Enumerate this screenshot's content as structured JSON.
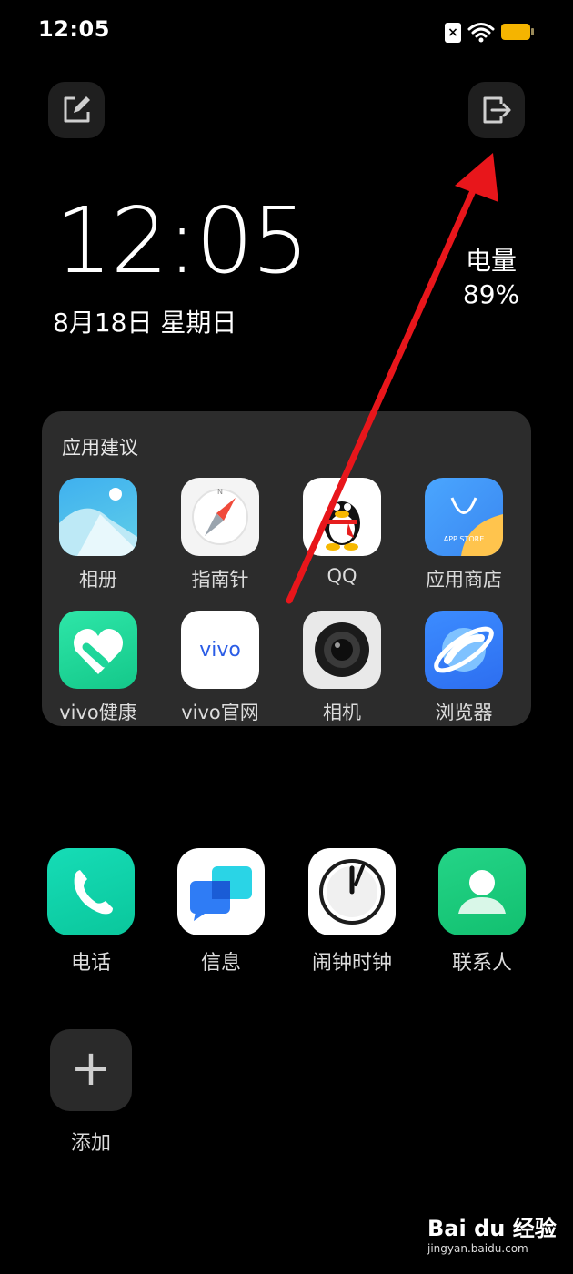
{
  "status_bar": {
    "time": "12:05",
    "sim_glyph": "×",
    "icons": [
      "sim-off-icon",
      "wifi-icon",
      "battery-icon"
    ]
  },
  "clock": {
    "time": "12:05",
    "date": "8月18日  星期日"
  },
  "battery_widget": {
    "label": "电量",
    "value": "89%"
  },
  "suggestions": {
    "title": "应用建议",
    "apps": [
      {
        "label": "相册",
        "icon": "gallery-icon"
      },
      {
        "label": "指南针",
        "icon": "compass-icon"
      },
      {
        "label": "QQ",
        "icon": "qq-icon"
      },
      {
        "label": "应用商店",
        "icon": "app-store-icon",
        "badge": "APP STORE"
      },
      {
        "label": "vivo健康",
        "icon": "health-icon"
      },
      {
        "label": "vivo官网",
        "icon": "vivo-site-icon",
        "logo_text": "vivo"
      },
      {
        "label": "相机",
        "icon": "camera-icon"
      },
      {
        "label": "浏览器",
        "icon": "browser-icon"
      }
    ]
  },
  "dock": {
    "apps": [
      {
        "label": "电话",
        "icon": "phone-icon"
      },
      {
        "label": "信息",
        "icon": "messages-icon"
      },
      {
        "label": "闹钟时钟",
        "icon": "clock-icon"
      },
      {
        "label": "联系人",
        "icon": "contacts-icon"
      }
    ]
  },
  "add": {
    "label": "添加",
    "glyph": "+"
  },
  "watermark": {
    "logo": "Bai du 经验",
    "url": "jingyan.baidu.com"
  },
  "colors": {
    "background": "#000000",
    "card": "#2c2c2c",
    "annotation_arrow": "#e8161b",
    "battery": "#f5b400"
  }
}
